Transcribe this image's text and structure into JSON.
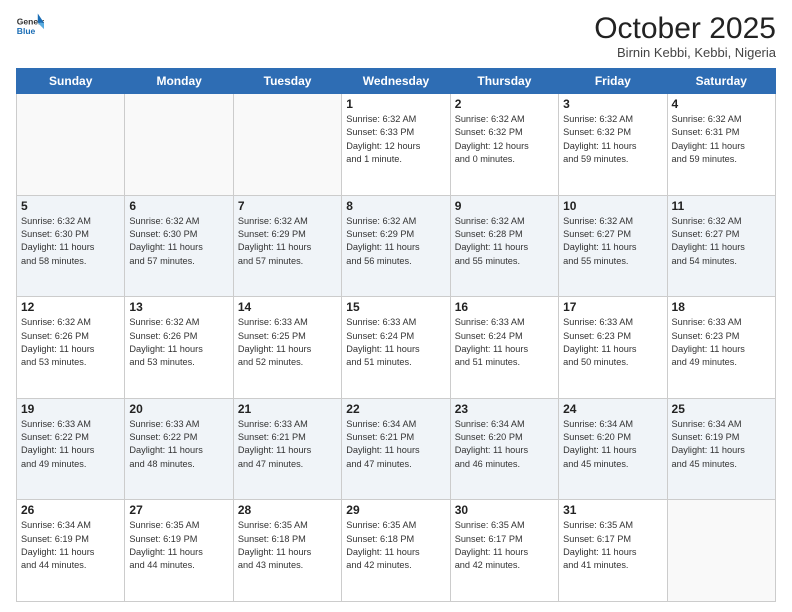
{
  "logo": {
    "general": "General",
    "blue": "Blue"
  },
  "header": {
    "month": "October 2025",
    "location": "Birnin Kebbi, Kebbi, Nigeria"
  },
  "days_of_week": [
    "Sunday",
    "Monday",
    "Tuesday",
    "Wednesday",
    "Thursday",
    "Friday",
    "Saturday"
  ],
  "weeks": [
    [
      {
        "day": "",
        "info": ""
      },
      {
        "day": "",
        "info": ""
      },
      {
        "day": "",
        "info": ""
      },
      {
        "day": "1",
        "info": "Sunrise: 6:32 AM\nSunset: 6:33 PM\nDaylight: 12 hours\nand 1 minute."
      },
      {
        "day": "2",
        "info": "Sunrise: 6:32 AM\nSunset: 6:32 PM\nDaylight: 12 hours\nand 0 minutes."
      },
      {
        "day": "3",
        "info": "Sunrise: 6:32 AM\nSunset: 6:32 PM\nDaylight: 11 hours\nand 59 minutes."
      },
      {
        "day": "4",
        "info": "Sunrise: 6:32 AM\nSunset: 6:31 PM\nDaylight: 11 hours\nand 59 minutes."
      }
    ],
    [
      {
        "day": "5",
        "info": "Sunrise: 6:32 AM\nSunset: 6:30 PM\nDaylight: 11 hours\nand 58 minutes."
      },
      {
        "day": "6",
        "info": "Sunrise: 6:32 AM\nSunset: 6:30 PM\nDaylight: 11 hours\nand 57 minutes."
      },
      {
        "day": "7",
        "info": "Sunrise: 6:32 AM\nSunset: 6:29 PM\nDaylight: 11 hours\nand 57 minutes."
      },
      {
        "day": "8",
        "info": "Sunrise: 6:32 AM\nSunset: 6:29 PM\nDaylight: 11 hours\nand 56 minutes."
      },
      {
        "day": "9",
        "info": "Sunrise: 6:32 AM\nSunset: 6:28 PM\nDaylight: 11 hours\nand 55 minutes."
      },
      {
        "day": "10",
        "info": "Sunrise: 6:32 AM\nSunset: 6:27 PM\nDaylight: 11 hours\nand 55 minutes."
      },
      {
        "day": "11",
        "info": "Sunrise: 6:32 AM\nSunset: 6:27 PM\nDaylight: 11 hours\nand 54 minutes."
      }
    ],
    [
      {
        "day": "12",
        "info": "Sunrise: 6:32 AM\nSunset: 6:26 PM\nDaylight: 11 hours\nand 53 minutes."
      },
      {
        "day": "13",
        "info": "Sunrise: 6:32 AM\nSunset: 6:26 PM\nDaylight: 11 hours\nand 53 minutes."
      },
      {
        "day": "14",
        "info": "Sunrise: 6:33 AM\nSunset: 6:25 PM\nDaylight: 11 hours\nand 52 minutes."
      },
      {
        "day": "15",
        "info": "Sunrise: 6:33 AM\nSunset: 6:24 PM\nDaylight: 11 hours\nand 51 minutes."
      },
      {
        "day": "16",
        "info": "Sunrise: 6:33 AM\nSunset: 6:24 PM\nDaylight: 11 hours\nand 51 minutes."
      },
      {
        "day": "17",
        "info": "Sunrise: 6:33 AM\nSunset: 6:23 PM\nDaylight: 11 hours\nand 50 minutes."
      },
      {
        "day": "18",
        "info": "Sunrise: 6:33 AM\nSunset: 6:23 PM\nDaylight: 11 hours\nand 49 minutes."
      }
    ],
    [
      {
        "day": "19",
        "info": "Sunrise: 6:33 AM\nSunset: 6:22 PM\nDaylight: 11 hours\nand 49 minutes."
      },
      {
        "day": "20",
        "info": "Sunrise: 6:33 AM\nSunset: 6:22 PM\nDaylight: 11 hours\nand 48 minutes."
      },
      {
        "day": "21",
        "info": "Sunrise: 6:33 AM\nSunset: 6:21 PM\nDaylight: 11 hours\nand 47 minutes."
      },
      {
        "day": "22",
        "info": "Sunrise: 6:34 AM\nSunset: 6:21 PM\nDaylight: 11 hours\nand 47 minutes."
      },
      {
        "day": "23",
        "info": "Sunrise: 6:34 AM\nSunset: 6:20 PM\nDaylight: 11 hours\nand 46 minutes."
      },
      {
        "day": "24",
        "info": "Sunrise: 6:34 AM\nSunset: 6:20 PM\nDaylight: 11 hours\nand 45 minutes."
      },
      {
        "day": "25",
        "info": "Sunrise: 6:34 AM\nSunset: 6:19 PM\nDaylight: 11 hours\nand 45 minutes."
      }
    ],
    [
      {
        "day": "26",
        "info": "Sunrise: 6:34 AM\nSunset: 6:19 PM\nDaylight: 11 hours\nand 44 minutes."
      },
      {
        "day": "27",
        "info": "Sunrise: 6:35 AM\nSunset: 6:19 PM\nDaylight: 11 hours\nand 44 minutes."
      },
      {
        "day": "28",
        "info": "Sunrise: 6:35 AM\nSunset: 6:18 PM\nDaylight: 11 hours\nand 43 minutes."
      },
      {
        "day": "29",
        "info": "Sunrise: 6:35 AM\nSunset: 6:18 PM\nDaylight: 11 hours\nand 42 minutes."
      },
      {
        "day": "30",
        "info": "Sunrise: 6:35 AM\nSunset: 6:17 PM\nDaylight: 11 hours\nand 42 minutes."
      },
      {
        "day": "31",
        "info": "Sunrise: 6:35 AM\nSunset: 6:17 PM\nDaylight: 11 hours\nand 41 minutes."
      },
      {
        "day": "",
        "info": ""
      }
    ]
  ]
}
